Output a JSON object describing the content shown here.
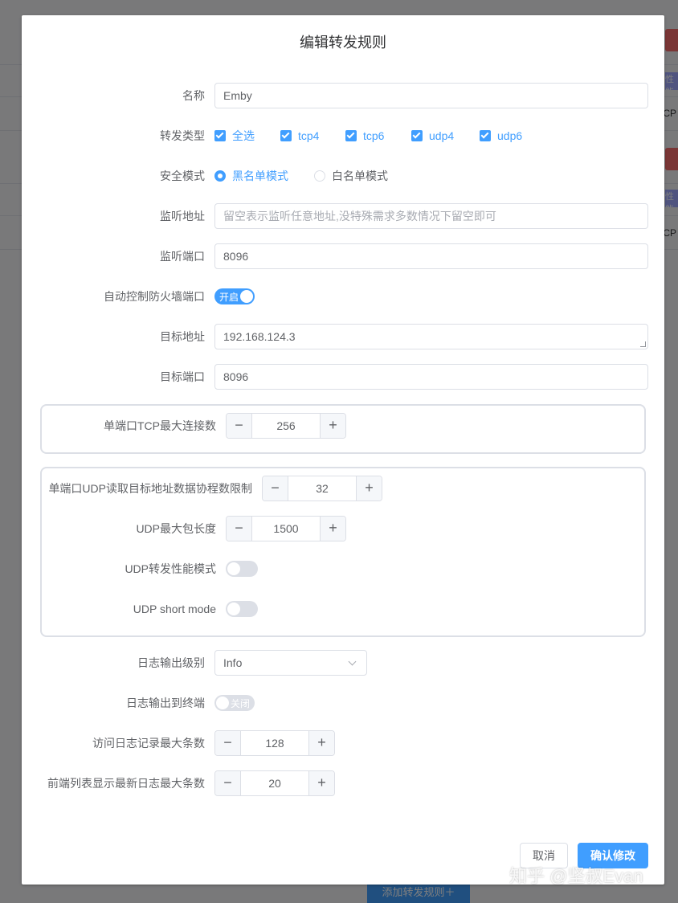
{
  "dialog": {
    "title": "编辑转发规则"
  },
  "fields": {
    "name": {
      "label": "名称",
      "value": "Emby"
    },
    "forward_type": {
      "label": "转发类型",
      "options": [
        "全选",
        "tcp4",
        "tcp6",
        "udp4",
        "udp6"
      ],
      "checked": [
        true,
        true,
        true,
        true,
        true
      ]
    },
    "security_mode": {
      "label": "安全模式",
      "options": [
        "黑名单模式",
        "白名单模式"
      ],
      "selected": "黑名单模式"
    },
    "listen_addr": {
      "label": "监听地址",
      "value": "",
      "placeholder": "留空表示监听任意地址,没特殊需求多数情况下留空即可"
    },
    "listen_port": {
      "label": "监听端口",
      "value": "8096"
    },
    "auto_firewall": {
      "label": "自动控制防火墙端口",
      "state_text": "开启",
      "on": true
    },
    "target_addr": {
      "label": "目标地址",
      "value": "192.168.124.3"
    },
    "target_port": {
      "label": "目标端口",
      "value": "8096"
    },
    "tcp_max_conn": {
      "label": "单端口TCP最大连接数",
      "value": "256"
    },
    "udp_read_limit": {
      "label": "单端口UDP读取目标地址数据协程数限制",
      "value": "32"
    },
    "udp_max_packet": {
      "label": "UDP最大包长度",
      "value": "1500"
    },
    "udp_perf_mode": {
      "label": "UDP转发性能模式",
      "on": false
    },
    "udp_short_mode": {
      "label": "UDP short mode",
      "on": false
    },
    "log_level": {
      "label": "日志输出级别",
      "value": "Info"
    },
    "log_to_terminal": {
      "label": "日志输出到终端",
      "state_text": "关闭",
      "on": false
    },
    "access_log_max": {
      "label": "访问日志记录最大条数",
      "value": "128"
    },
    "frontend_log_max": {
      "label": "前端列表显示最新日志最大条数",
      "value": "20"
    }
  },
  "buttons": {
    "cancel": "取消",
    "confirm": "确认修改"
  },
  "stepper_icons": {
    "minus": "−",
    "plus": "+"
  },
  "background": {
    "add_rule_button": "添加转发规则＋",
    "tag_text_1": "CP",
    "tag_text_2": "CP",
    "badge_1": "性能",
    "badge_2": "性能"
  },
  "watermark": "知乎 @坚叔Evan",
  "colors": {
    "accent": "#409eff",
    "danger": "#f56c6c"
  }
}
